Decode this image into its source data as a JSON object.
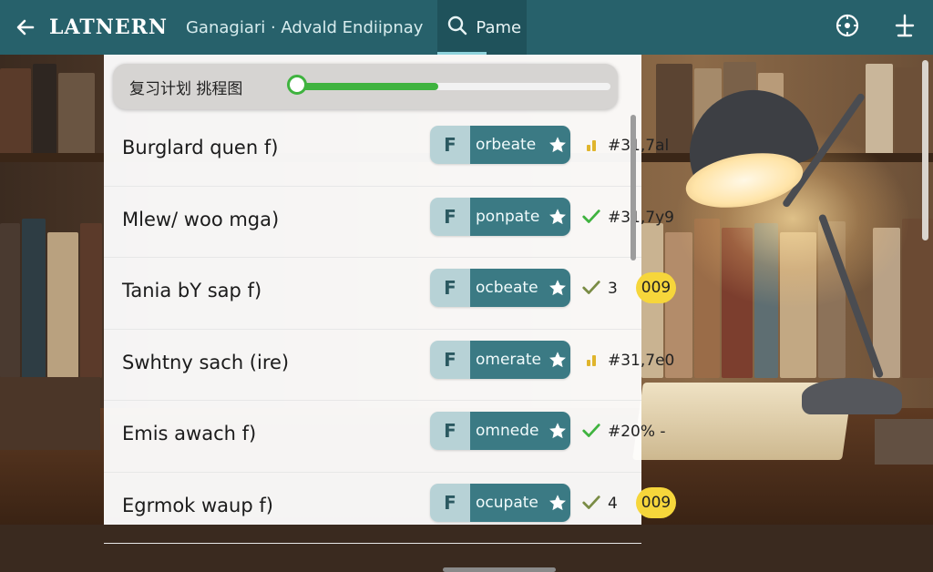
{
  "header": {
    "brand": "LATNERN",
    "subtitle": "Ganagiari · Advald Endiipnay",
    "search_tab_label": "Pame"
  },
  "progress": {
    "label": "复习计划  挑程图",
    "fraction": 0.45
  },
  "rows": [
    {
      "title": "Burglard quen f)",
      "badge_letter": "F",
      "action": "orbeate",
      "status": "dot",
      "value": "#31,7al",
      "badge_value": ""
    },
    {
      "title": "Mlew/ woo mga)",
      "badge_letter": "F",
      "action": "ponpate",
      "status": "check",
      "value": "#31,7y9",
      "badge_value": ""
    },
    {
      "title": "Tania bY sap f)",
      "badge_letter": "F",
      "action": "ocbeate",
      "status": "check-olive",
      "value": "3",
      "badge_value": "009"
    },
    {
      "title": "Swhtny sach (ire)",
      "badge_letter": "F",
      "action": "omerate",
      "status": "dot",
      "value": "#31,7e0",
      "badge_value": ""
    },
    {
      "title": "Emis awach f)",
      "badge_letter": "F",
      "action": "omnede",
      "status": "check",
      "value": "#20% -",
      "badge_value": ""
    },
    {
      "title": "Egrmok waup f)",
      "badge_letter": "F",
      "action": "ocupate",
      "status": "check-olive",
      "value": "4",
      "badge_value": "009"
    }
  ],
  "colors": {
    "topbar": "#27616b",
    "accent_green": "#3fb33f",
    "badge_yellow": "#f6d63b",
    "pill_dark": "#3b7a84"
  }
}
